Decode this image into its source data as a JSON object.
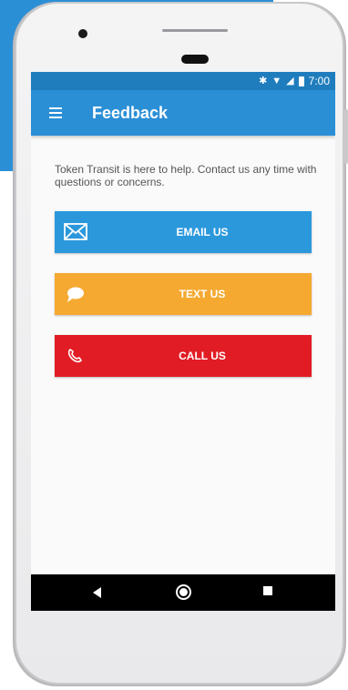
{
  "status_bar": {
    "time": "7:00",
    "icons": [
      "bluetooth-icon",
      "wifi-icon",
      "signal-icon",
      "battery-icon"
    ]
  },
  "app_bar": {
    "title": "Feedback",
    "menu_icon": "hamburger-menu-icon"
  },
  "content": {
    "help_text": "Token Transit is here to help. Contact us any time with questions or concerns.",
    "buttons": [
      {
        "label": "EMAIL US",
        "icon": "envelope-icon",
        "color": "#2b98dc"
      },
      {
        "label": "TEXT US",
        "icon": "speech-bubble-icon",
        "color": "#f5a931"
      },
      {
        "label": "CALL US",
        "icon": "phone-icon",
        "color": "#e21c24"
      }
    ]
  },
  "nav_bar": {
    "icons": [
      "back-icon",
      "home-icon",
      "recent-apps-icon"
    ]
  },
  "colors": {
    "primary": "#2b8fd6",
    "status_bar": "#1f7dbd"
  }
}
